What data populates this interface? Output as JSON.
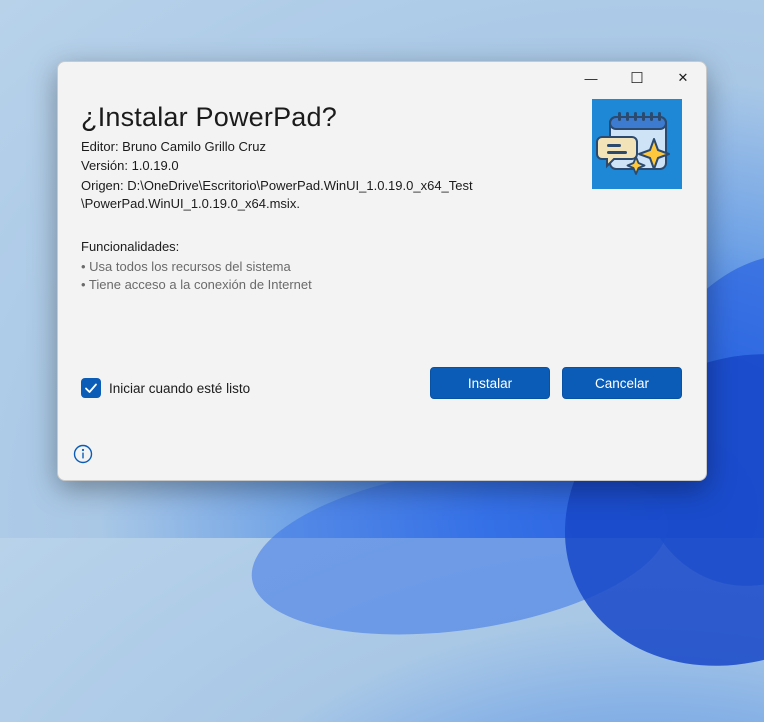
{
  "window": {
    "minimize_glyph": "—",
    "maximize_glyph": "☐",
    "close_glyph": "✕"
  },
  "installer": {
    "title": "¿Instalar PowerPad?",
    "publisher": "Editor: Bruno Camilo Grillo Cruz",
    "version": "Versión: 1.0.19.0",
    "origin_line1": "Origen: D:\\OneDrive\\Escritorio\\PowerPad.WinUI_1.0.19.0_x64_Test",
    "origin_line2": "\\PowerPad.WinUI_1.0.19.0_x64.msix.",
    "features_title": "Funcionalidades:",
    "features": [
      "• Usa todos los recursos del sistema",
      "• Tiene acceso a la conexión de Internet"
    ],
    "launch_checkbox": {
      "label": "Iniciar cuando esté listo",
      "checked": true
    },
    "install_button": "Instalar",
    "cancel_button": "Cancelar",
    "app_icon": "powerpad-notepad-sparkle-icon",
    "info_icon": "info-icon"
  },
  "colors": {
    "accent": "#0a5cb7",
    "dialog_bg": "#f3f3f3",
    "app_icon_bg": "#1e88d6"
  }
}
